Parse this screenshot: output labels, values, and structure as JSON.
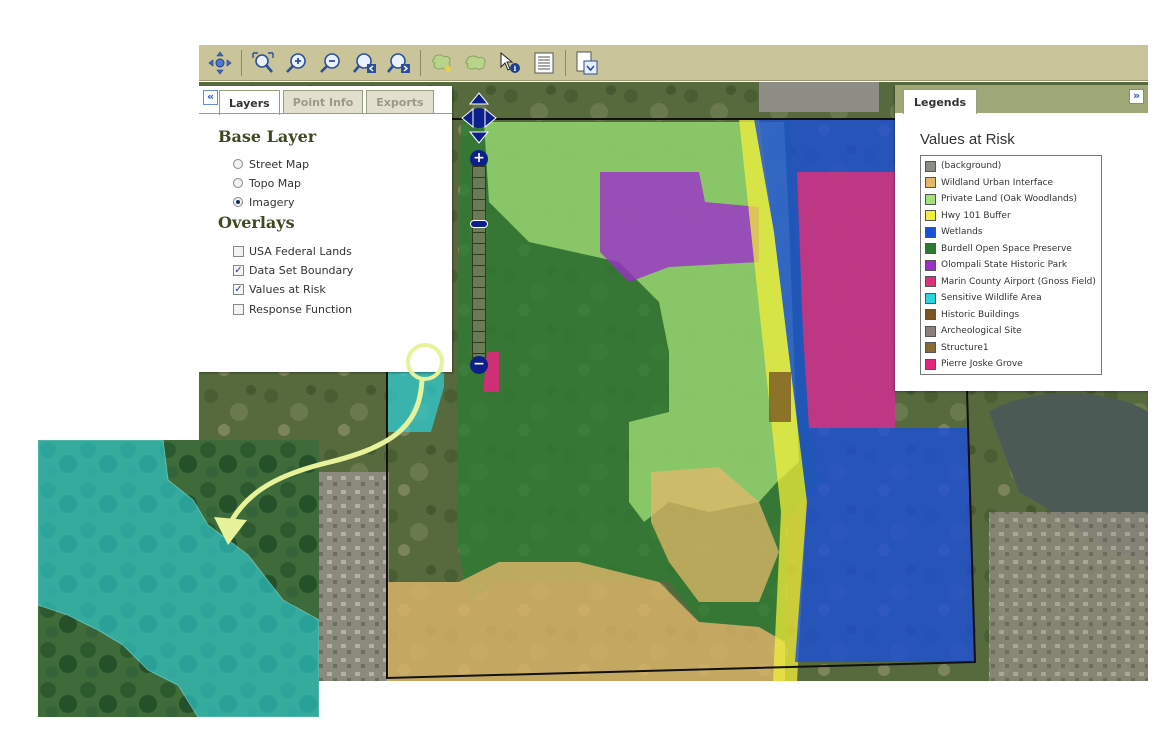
{
  "toolbar": {
    "tools": [
      {
        "name": "pan-icon",
        "label": "Pan"
      },
      {
        "name": "full-extent-icon",
        "label": "Full Extent"
      },
      {
        "name": "zoom-in-icon",
        "label": "Zoom In"
      },
      {
        "name": "zoom-out-icon",
        "label": "Zoom Out"
      },
      {
        "name": "zoom-previous-icon",
        "label": "Previous Extent"
      },
      {
        "name": "zoom-next-icon",
        "label": "Next Extent"
      },
      {
        "name": "select-area-icon",
        "label": "Select"
      },
      {
        "name": "clear-selection-icon",
        "label": "Clear"
      },
      {
        "name": "identify-icon",
        "label": "Identify"
      },
      {
        "name": "table-icon",
        "label": "Table"
      },
      {
        "name": "export-icon",
        "label": "Export"
      }
    ]
  },
  "left_panel": {
    "collapse_glyph": "«",
    "tabs": [
      "Layers",
      "Point Info",
      "Exports"
    ],
    "active_tab": "Layers",
    "base_layer_heading": "Base Layer",
    "base_layers": [
      {
        "label": "Street Map",
        "selected": false
      },
      {
        "label": "Topo Map",
        "selected": false
      },
      {
        "label": "Imagery",
        "selected": true
      }
    ],
    "overlays_heading": "Overlays",
    "overlays": [
      {
        "label": "USA Federal Lands",
        "checked": false
      },
      {
        "label": "Data Set Boundary",
        "checked": true
      },
      {
        "label": "Values at Risk",
        "checked": true
      },
      {
        "label": "Response Function",
        "checked": false
      }
    ]
  },
  "right_panel": {
    "collapse_glyph": "»",
    "tab": "Legends",
    "title": "Values at Risk",
    "legend": [
      {
        "label": "(background)",
        "color": "#8c8c84"
      },
      {
        "label": "Wildland Urban Interface",
        "color": "#e3b86a"
      },
      {
        "label": "Private Land (Oak Woodlands)",
        "color": "#a6e07a"
      },
      {
        "label": "Hwy 101 Buffer",
        "color": "#f2ee3a"
      },
      {
        "label": "Wetlands",
        "color": "#1b4fd8"
      },
      {
        "label": "Burdell Open Space Preserve",
        "color": "#2f7a33"
      },
      {
        "label": "Olompali State Historic Park",
        "color": "#9b30c9"
      },
      {
        "label": "Marin County Airport (Gnoss Field)",
        "color": "#d8337a"
      },
      {
        "label": "Sensitive Wildlife Area",
        "color": "#2fd3dc"
      },
      {
        "label": "Historic Buildings",
        "color": "#7a5522"
      },
      {
        "label": "Archeological Site",
        "color": "#8a7f7c"
      },
      {
        "label": "Structure1",
        "color": "#8b6a3a"
      },
      {
        "label": "Pierre Joske Grove",
        "color": "#e0277a"
      }
    ]
  },
  "map": {
    "zoom_in_glyph": "+",
    "zoom_out_glyph": "−"
  }
}
